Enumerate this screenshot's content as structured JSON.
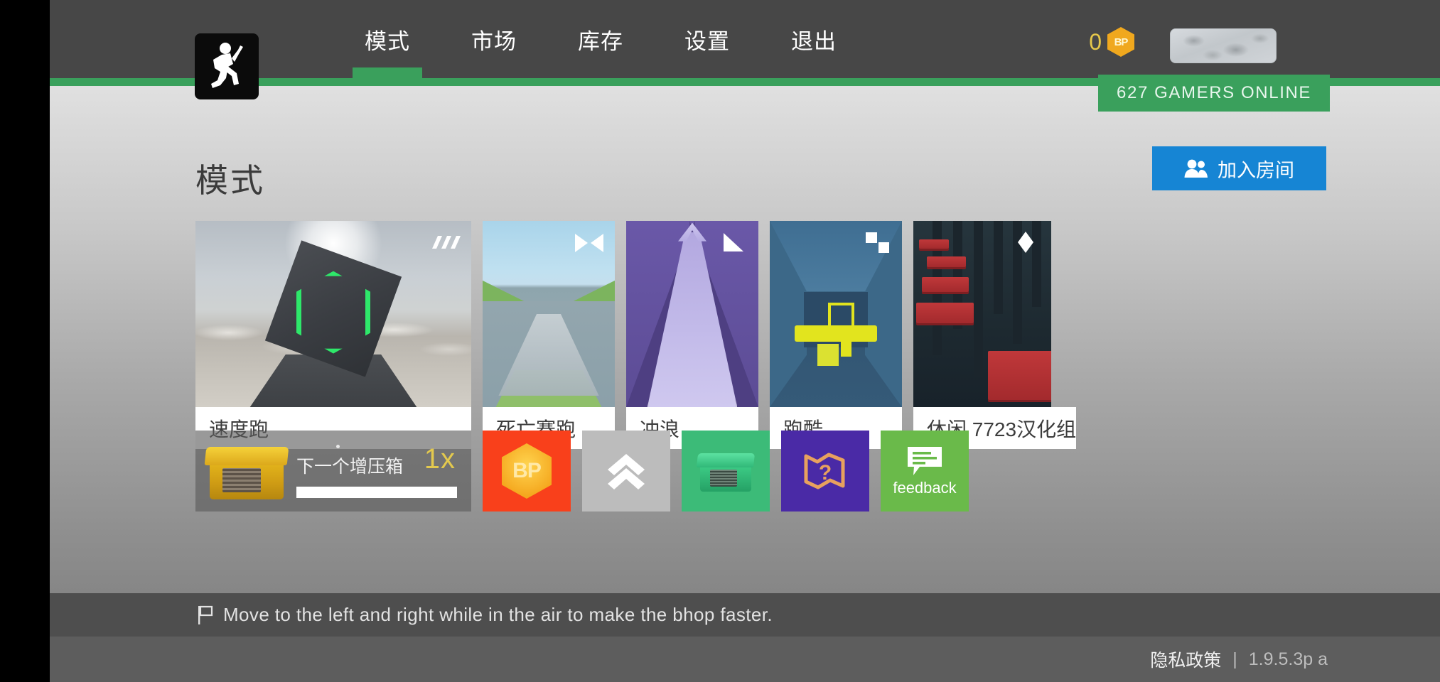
{
  "app": {
    "logo_icon": "running-figure-logo"
  },
  "nav": {
    "items": [
      {
        "label": "模式",
        "active": true
      },
      {
        "label": "市场",
        "active": false
      },
      {
        "label": "库存",
        "active": false
      },
      {
        "label": "设置",
        "active": false
      },
      {
        "label": "退出",
        "active": false
      }
    ],
    "currency": {
      "amount": "0",
      "badge_text": "BP",
      "badge_icon": "bp-hex-icon"
    },
    "avatar_icon": "avatar-placeholder",
    "online_badge": "627 GAMERS ONLINE"
  },
  "main": {
    "page_title": "模式",
    "join_room": {
      "label": "加入房间",
      "icon": "people-icon"
    },
    "cards": [
      {
        "label": "速度跑",
        "badge_icon": "speed-bars-icon"
      },
      {
        "label": "死亡赛跑",
        "badge_icon": "hourglass-icon"
      },
      {
        "label": "冲浪",
        "badge_icon": "triangle-ramp-icon"
      },
      {
        "label": "跑酷",
        "badge_icon": "two-squares-icon"
      },
      {
        "label": "休闲  7723汉化组",
        "badge_icon": "diamond-icon"
      }
    ],
    "crate": {
      "icon": "yellow-crate-icon",
      "name": "下一个增压箱",
      "multiplier": "1x",
      "progress_percent": 100
    },
    "tiles": [
      {
        "name": "bp-tile",
        "icon": "bp-hex-icon",
        "label": "BP",
        "color": "#f9401b"
      },
      {
        "name": "boost-tile",
        "icon": "double-chevron-up-icon",
        "label": "",
        "color": "#bcbcbc"
      },
      {
        "name": "crate-tile",
        "icon": "green-crate-icon",
        "label": "",
        "color": "#3cbb78"
      },
      {
        "name": "map-tile",
        "icon": "map-question-icon",
        "label": "",
        "color": "#4a2aa6"
      },
      {
        "name": "feedback-tile",
        "icon": "speech-bubble-icon",
        "label": "feedback",
        "color": "#6aba4a"
      }
    ]
  },
  "tip": {
    "icon": "flag-icon",
    "text": "Move to the left and right while in the air to make the bhop faster."
  },
  "footer": {
    "privacy_label": "隐私政策",
    "separator": "|",
    "version": "1.9.5.3p a"
  },
  "colors": {
    "nav_bg": "#474747",
    "accent_green": "#3aa05c",
    "join_blue": "#1685d4",
    "crate_yellow": "#e3c94e"
  }
}
